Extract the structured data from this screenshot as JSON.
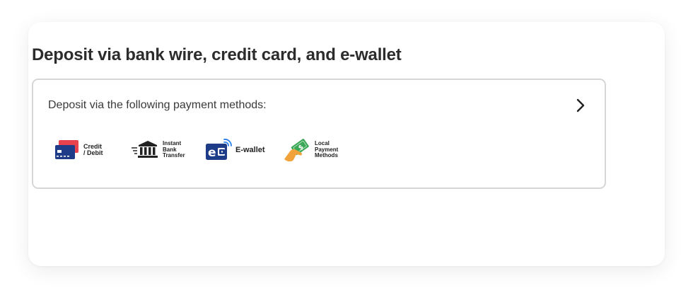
{
  "section": {
    "title": "Deposit via bank wire, credit card, and e-wallet"
  },
  "payment_box": {
    "text": "Deposit via the following payment methods:",
    "chevron_icon": "chevron-right-icon"
  },
  "methods": [
    {
      "label": "Credit\n/ Debit",
      "icon": "credit-card-icon"
    },
    {
      "label": "Instant\nBank\nTransfer",
      "icon": "bank-icon"
    },
    {
      "label": "E-wallet",
      "icon": "e-wallet-icon"
    },
    {
      "label": "Local\nPayment\nMethods",
      "icon": "cash-hand-icon"
    }
  ],
  "colors": {
    "title": "#2c2c2c",
    "border": "#d6d6d6",
    "navy": "#1f3c88",
    "red": "#e8424e",
    "green": "#3aa856",
    "orange": "#f2a23a"
  }
}
